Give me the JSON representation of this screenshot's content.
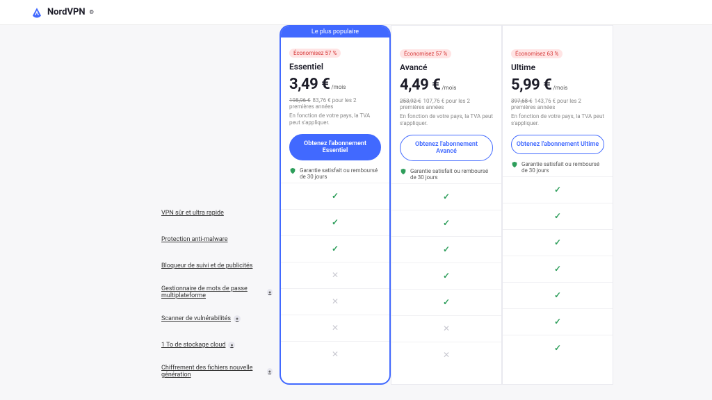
{
  "brand": {
    "name": "NordVPN",
    "reg": "®"
  },
  "popular_label": "Le plus populaire",
  "guarantee_text": "Garantie satisfait ou remboursé de 30 jours",
  "vat_text": "En fonction de votre pays, la TVA peut s'appliquer.",
  "plans": [
    {
      "badge": "Économisez 57 %",
      "name": "Essentiel",
      "price": "3,49 €",
      "unit": "/mois",
      "old": "198,96 €",
      "new": "83,76 €",
      "period": "pour les 2 premières années",
      "cta": "Obtenez l'abonnement Essentiel",
      "featured": true
    },
    {
      "badge": "Économisez 57 %",
      "name": "Avancé",
      "price": "4,49 €",
      "unit": "/mois",
      "old": "253,92 €",
      "new": "107,76 €",
      "period": "pour les 2 premières années",
      "cta": "Obtenez l'abonnement Avancé",
      "featured": false
    },
    {
      "badge": "Économisez 63 %",
      "name": "Ultime",
      "price": "5,99 €",
      "unit": "/mois",
      "old": "397,68 €",
      "new": "143,76 €",
      "period": "pour les 2 premières années",
      "cta": "Obtenez l'abonnement Ultime",
      "featured": false
    }
  ],
  "features": [
    {
      "label": "VPN sûr et ultra rapide",
      "info": false,
      "vals": [
        "y",
        "y",
        "y"
      ]
    },
    {
      "label": "Protection anti-malware",
      "info": false,
      "vals": [
        "y",
        "y",
        "y"
      ]
    },
    {
      "label": "Bloqueur de suivi et de publicités",
      "info": false,
      "vals": [
        "y",
        "y",
        "y"
      ]
    },
    {
      "label": "Gestionnaire de mots de passe multiplateforme",
      "info": true,
      "vals": [
        "n",
        "y",
        "y"
      ]
    },
    {
      "label": "Scanner de vulnérabilités",
      "info": true,
      "vals": [
        "n",
        "y",
        "y"
      ]
    },
    {
      "label": "1 To de stockage cloud",
      "info": true,
      "vals": [
        "n",
        "n",
        "y"
      ]
    },
    {
      "label": "Chiffrement des fichiers nouvelle génération",
      "info": true,
      "vals": [
        "n",
        "n",
        "y"
      ]
    }
  ]
}
